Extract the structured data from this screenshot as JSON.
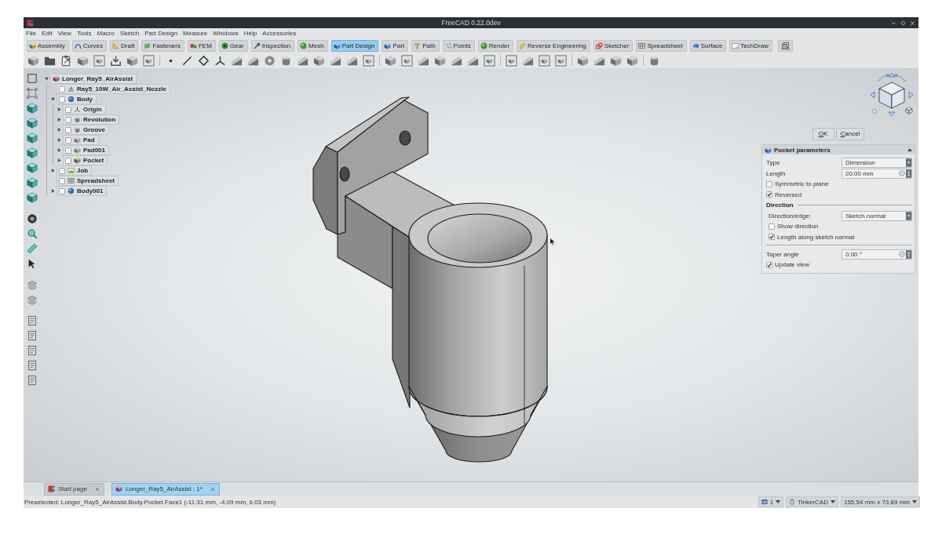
{
  "window": {
    "title": "FreeCAD 0.22.0dev"
  },
  "menu": [
    "File",
    "Edit",
    "View",
    "Tools",
    "Macro",
    "Sketch",
    "Part Design",
    "Measure",
    "Windows",
    "Help",
    "Accessories"
  ],
  "workbenches": [
    {
      "label": "Assembly",
      "selected": false
    },
    {
      "label": "Curves",
      "selected": false
    },
    {
      "label": "Draft",
      "selected": false
    },
    {
      "label": "Fasteners",
      "selected": false
    },
    {
      "label": "FEM",
      "selected": false
    },
    {
      "label": "Gear",
      "selected": false
    },
    {
      "label": "Inspection",
      "selected": false
    },
    {
      "label": "Mesh",
      "selected": false
    },
    {
      "label": "Part Design",
      "selected": true
    },
    {
      "label": "Part",
      "selected": false
    },
    {
      "label": "Path",
      "selected": false
    },
    {
      "label": "Points",
      "selected": false
    },
    {
      "label": "Render",
      "selected": false
    },
    {
      "label": "Reverse Engineering",
      "selected": false
    },
    {
      "label": "Sketcher",
      "selected": false
    },
    {
      "label": "Spreadsheet",
      "selected": false
    },
    {
      "label": "Surface",
      "selected": false
    },
    {
      "label": "TechDraw",
      "selected": false
    }
  ],
  "tree": [
    {
      "label": "Longer_Ray5_AirAssist",
      "kind": "document",
      "expanded": true,
      "children": [
        {
          "label": "Ray5_10W_Air_Assist_Nozzle",
          "kind": "mesh",
          "checked": false
        },
        {
          "label": "Body",
          "kind": "body",
          "checked": false,
          "expanded": true,
          "children": [
            {
              "label": "Origin",
              "kind": "origin",
              "checked": false,
              "expanded": false
            },
            {
              "label": "Revolution",
              "kind": "revolution",
              "checked": false,
              "expanded": false
            },
            {
              "label": "Groove",
              "kind": "revolution",
              "checked": false,
              "expanded": false
            },
            {
              "label": "Pad",
              "kind": "pad",
              "checked": false,
              "expanded": false
            },
            {
              "label": "Pad001",
              "kind": "pad",
              "checked": false,
              "expanded": false
            },
            {
              "label": "Pocket",
              "kind": "pocket",
              "checked": false,
              "expanded": false
            }
          ]
        },
        {
          "label": "Job",
          "kind": "job",
          "checked": false,
          "expanded": false
        },
        {
          "label": "Spreadsheet",
          "kind": "spreadsheet",
          "checked": false
        },
        {
          "label": "Body001",
          "kind": "body",
          "checked": false,
          "expanded": false
        }
      ]
    }
  ],
  "task": {
    "buttons": [
      "OK",
      "Cancel"
    ],
    "panel": {
      "title": "Pocket parameters",
      "expanded": true,
      "rows": [
        {
          "kind": "combo",
          "label": "Type",
          "value": "Dimension"
        },
        {
          "kind": "spin",
          "label": "Length",
          "value": "20.00 mm"
        },
        {
          "kind": "checkbox",
          "label": "Symmetric to plane",
          "checked": false
        },
        {
          "kind": "checkbox",
          "label": "Reversed",
          "checked": true
        },
        {
          "kind": "section",
          "label": "Direction",
          "rows": [
            {
              "kind": "combo",
              "label": "Direction/edge:",
              "value": "Sketch normal"
            },
            {
              "kind": "checkbox",
              "label": "Show direction",
              "checked": false
            },
            {
              "kind": "checkbox",
              "label": "Length along sketch normal",
              "checked": true
            }
          ]
        },
        {
          "kind": "spin",
          "label": "Taper angle",
          "value": "0.00 °"
        },
        {
          "kind": "checkbox",
          "label": "Update view",
          "checked": true
        }
      ]
    }
  },
  "tabs": [
    {
      "label": "Start page",
      "kind": "start",
      "selected": false
    },
    {
      "label": "Longer_Ray5_AirAssist : 1*",
      "kind": "document",
      "selected": true
    }
  ],
  "status_bar": {
    "message": "Preselected: Longer_Ray5_AirAssist.Body.Pocket.Face1 (-11.31 mm, -4.09 mm, 6.03 mm)",
    "widgets": [
      {
        "kind": "views",
        "label": "1"
      },
      {
        "kind": "navigation",
        "label": "TinkerCAD"
      },
      {
        "kind": "dimensions",
        "label": "155.54 mm x 73.89 mm"
      }
    ]
  }
}
